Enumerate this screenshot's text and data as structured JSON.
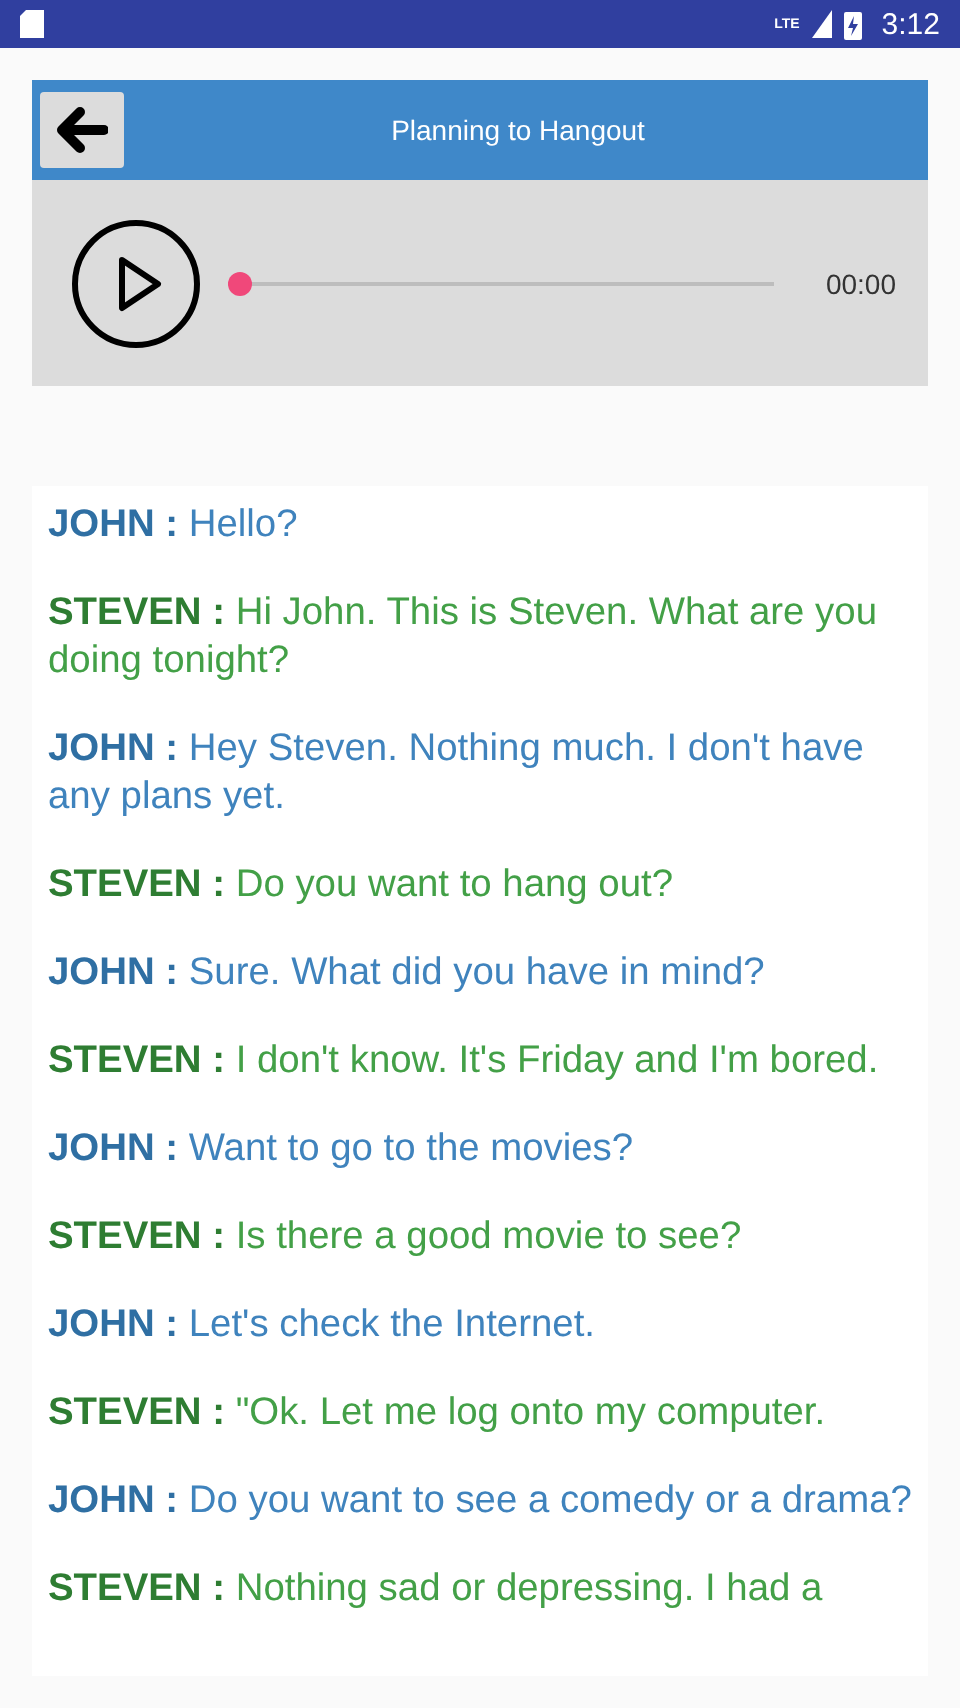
{
  "status_bar": {
    "time": "3:12",
    "network": "LTE"
  },
  "header": {
    "title": "Planning to Hangout"
  },
  "player": {
    "level": 0,
    "time": "00:00"
  },
  "dialogue": [
    {
      "kind": "john",
      "speaker": "JOHN :",
      "text": "Hello?"
    },
    {
      "kind": "steven",
      "speaker": "STEVEN :",
      "text": "Hi John. This is Steven. What are you doing tonight?"
    },
    {
      "kind": "john",
      "speaker": "JOHN :",
      "text": "Hey Steven. Nothing much. I don't have any plans yet."
    },
    {
      "kind": "steven",
      "speaker": "STEVEN :",
      "text": "Do you want to hang out?"
    },
    {
      "kind": "john",
      "speaker": "JOHN :",
      "text": "Sure. What did you have in mind?"
    },
    {
      "kind": "steven",
      "speaker": "STEVEN :",
      "text": "I don't know. It's Friday and I'm bored."
    },
    {
      "kind": "john",
      "speaker": "JOHN :",
      "text": "Want to go to the movies?"
    },
    {
      "kind": "steven",
      "speaker": "STEVEN :",
      "text": "Is there a good movie to see?"
    },
    {
      "kind": "john",
      "speaker": "JOHN :",
      "text": "Let's check the Internet."
    },
    {
      "kind": "steven",
      "speaker": "STEVEN :",
      "text": "\"Ok. Let me log onto my computer."
    },
    {
      "kind": "john",
      "speaker": "JOHN :",
      "text": "Do you want to see a comedy or a drama?"
    },
    {
      "kind": "steven",
      "speaker": "STEVEN :",
      "text": "Nothing sad or depressing. I had a"
    }
  ]
}
